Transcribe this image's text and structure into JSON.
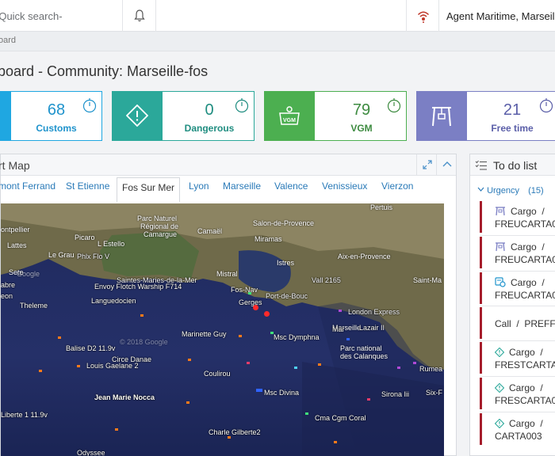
{
  "topbar": {
    "search_placeholder": "-Quick search-",
    "user_name": "Agent Maritime, Marseille-f"
  },
  "breadcrumb": "oard",
  "page_title": "board - Community: Marseille-fos",
  "cards": [
    {
      "value": "68",
      "label": "Customs",
      "color": "#1fa7e1",
      "icon": "customs-icon"
    },
    {
      "value": "0",
      "label": "Dangerous",
      "color": "#2ba89a",
      "icon": "dangerous-diamond-icon"
    },
    {
      "value": "79",
      "label": "VGM",
      "color": "#4caf50",
      "icon": "vgm-weight-icon"
    },
    {
      "value": "21",
      "label": "Free time",
      "color": "#7b7fc4",
      "icon": "crane-icon"
    }
  ],
  "map": {
    "title": "rt Map",
    "tabs": [
      "mont Ferrand",
      "St Etienne",
      "Fos Sur Mer",
      "Lyon",
      "Marseille",
      "Valence",
      "Venissieux",
      "Vierzon"
    ],
    "active_tab": "Fos Sur Mer",
    "places": [
      "Parc Naturel",
      "Régional de",
      "Camargue",
      "Salon-de-Provence",
      "Miramas",
      "Aix-en-Provence",
      "Pertuis",
      "Istres",
      "Saint-Ma",
      "Camaël",
      "Picaro",
      "L Estello",
      "ontpellier",
      "Lattes",
      "Le Grau",
      "Mistral",
      "Marseille",
      "Parc national",
      "des Calanques",
      "Sete",
      "Google",
      "© 2018 Google"
    ],
    "vessels": [
      "Phlx Flo V",
      "Saintes-Maries-de-la-Mer",
      "Envoy Flotch Warship F714",
      "abre",
      "eon",
      "Theleme",
      "Languedocien",
      "Marinette Guy",
      "Balise D2 11.9v",
      "Circe Danae",
      "Louis Gaelane 2",
      "Coulirou",
      "Msc Dymphna",
      "London Express",
      "Mar",
      "Lazair II",
      "Jean Marie Nocca",
      "Msc Divina",
      "Sirona Iii",
      "Six-F",
      "Cma Cgm Coral",
      "Liberte 1 11.9v",
      "Charle Gilberte2",
      "Odyssee",
      "Rumea",
      "Vall 2165",
      "Fos-Nav",
      "Port-de-Bouc",
      "Gerges"
    ]
  },
  "todo": {
    "title": "To do list",
    "urgency_label": "Urgency",
    "urgency_count": "(15)",
    "items": [
      {
        "icon": "crane-icon",
        "type": "Cargo",
        "sep": "/",
        "ref": "FREUCARTA0"
      },
      {
        "icon": "crane-icon",
        "type": "Cargo",
        "sep": "/",
        "ref": "FREUCARTA0"
      },
      {
        "icon": "customs-icon",
        "type": "Cargo",
        "sep": "/",
        "ref": "FREUCARTA0"
      },
      {
        "icon": "",
        "type": "Call",
        "sep": "/",
        "ref": "PREFF"
      },
      {
        "icon": "dangerous-diamond-icon",
        "type": "Cargo",
        "sep": "/",
        "ref": "FRESTCARTA"
      },
      {
        "icon": "dangerous-diamond-icon",
        "type": "Cargo",
        "sep": "/",
        "ref": "FRESCARTA0"
      },
      {
        "icon": "dangerous-diamond-icon",
        "type": "Cargo",
        "sep": "/",
        "ref": "CARTA003"
      }
    ]
  }
}
